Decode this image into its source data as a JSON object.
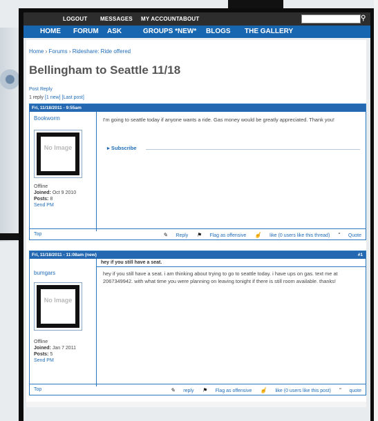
{
  "topnav": {
    "logout": "LOGOUT",
    "messages": "MESSAGES",
    "my_account": "MY ACCOUNT",
    "about": "ABOUT"
  },
  "mainnav": {
    "home": "HOME",
    "forum": "FORUM",
    "ask": "ASK",
    "groups": "GROUPS *NEW*",
    "blogs": "BLOGS",
    "gallery": "THE GALLERY"
  },
  "breadcrumb": {
    "home": "Home",
    "forums": "Forums",
    "section": "Rideshare: Ride offered",
    "sep": "›"
  },
  "page_title": "Bellingham to Seattle 11/18",
  "post_reply": "Post Reply",
  "reply_stats": {
    "count": "1 reply",
    "new": "[1 new]",
    "last": "[Last post]"
  },
  "posts": [
    {
      "date": "Fri, 11/18/2011 - 9:55am",
      "number": "",
      "author": "Bookworm",
      "avatar": "No Image",
      "status": "Offline",
      "joined_label": "Joined:",
      "joined": "Oct 9 2010",
      "posts_label": "Posts:",
      "posts": "8",
      "send_pm": "Send PM",
      "subject": "",
      "body": "I'm going to seattle today if anyone wants a ride. Gas money would be greatly appreciated. Thank you!",
      "subscribe": "Subscribe",
      "foot": {
        "top": "Top",
        "reply": "Reply",
        "flag": "Flag as offensive",
        "like": "like (0 users like this thread)",
        "quote": "Quote"
      }
    },
    {
      "date": "Fri, 11/18/2011 - 11:08am (new)",
      "number": "#1",
      "author": "bumgars",
      "avatar": "No Image",
      "status": "Offline",
      "joined_label": "Joined:",
      "joined": "Jan 7 2011",
      "posts_label": "Posts:",
      "posts": "5",
      "send_pm": "Send PM",
      "subject": "hey if you still have a seat.",
      "body": "hey if you still have a seat. i am thinking about trying to go to seattle today. i have ups on gas. text me at 2067349942. with what time you were planning on leaving tonight if there is still room available. thanks!",
      "foot": {
        "top": "Top",
        "reply": "reply",
        "flag": "Flag as offensive",
        "like": "like (0 users like this post)",
        "quote": "quote"
      }
    }
  ],
  "icons": {
    "search": "search-icon",
    "reply": "pencil-icon",
    "flag": "flag-icon",
    "like": "thumbs-up-icon",
    "quote": "quote-icon"
  },
  "colors": {
    "nav_blue": "#1966b0",
    "top_nav": "#2d2d2d",
    "link": "#1e6bb8"
  }
}
